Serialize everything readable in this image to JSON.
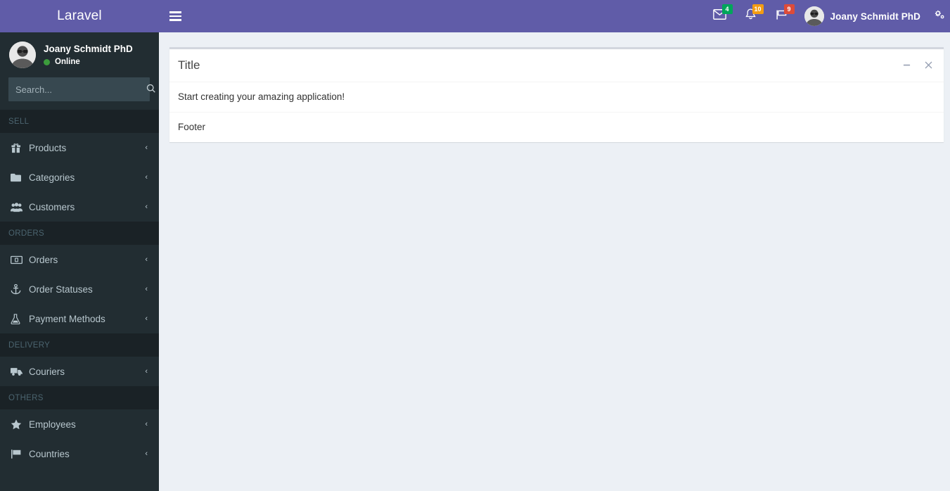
{
  "brand": {
    "logo_text": "Laravel",
    "primary_color": "#605ca8",
    "sidebar_color": "#222d32"
  },
  "navbar": {
    "toggle_label": "Toggle navigation",
    "messages": {
      "icon": "envelope-icon",
      "count": "4",
      "color": "#00a65a"
    },
    "notifications": {
      "icon": "bell-icon",
      "count": "10",
      "color": "#f39c12"
    },
    "tasks": {
      "icon": "flag-icon",
      "count": "9",
      "color": "#dd4b39"
    },
    "user_name": "Joany Schmidt PhD",
    "settings_icon": "cogs-icon"
  },
  "sidebar": {
    "user": {
      "name": "Joany Schmidt PhD",
      "status": "Online",
      "status_color": "#3c9d3c"
    },
    "search": {
      "placeholder": "Search...",
      "value": "",
      "icon": "search-icon"
    },
    "sections": [
      {
        "header": "SELL",
        "items": [
          {
            "label": "Products",
            "icon": "gift-icon",
            "arrow": "‹"
          },
          {
            "label": "Categories",
            "icon": "folder-icon",
            "arrow": "‹"
          },
          {
            "label": "Customers",
            "icon": "users-icon",
            "arrow": "‹"
          }
        ]
      },
      {
        "header": "ORDERS",
        "items": [
          {
            "label": "Orders",
            "icon": "money-bill-icon",
            "arrow": "‹"
          },
          {
            "label": "Order Statuses",
            "icon": "anchor-icon",
            "arrow": "‹"
          },
          {
            "label": "Payment Methods",
            "icon": "flask-icon",
            "arrow": "‹"
          }
        ]
      },
      {
        "header": "DELIVERY",
        "items": [
          {
            "label": "Couriers",
            "icon": "truck-icon",
            "arrow": "‹"
          }
        ]
      },
      {
        "header": "OTHERS",
        "items": [
          {
            "label": "Employees",
            "icon": "star-icon",
            "arrow": "‹"
          },
          {
            "label": "Countries",
            "icon": "flag-icon",
            "arrow": "‹"
          }
        ]
      }
    ]
  },
  "card": {
    "title": "Title",
    "body_text": "Start creating your amazing application!",
    "footer_text": "Footer",
    "tools": {
      "collapse_icon": "minus-icon",
      "remove_icon": "times-icon"
    }
  }
}
